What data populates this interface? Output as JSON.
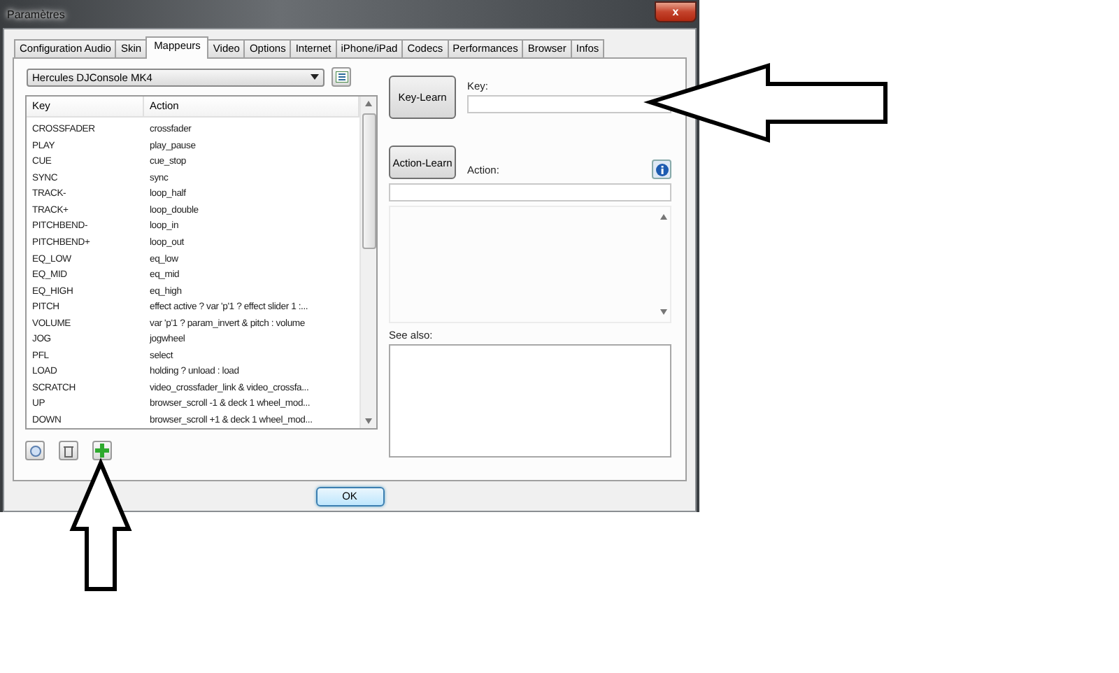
{
  "window": {
    "title": "Paramètres",
    "close_label": "x"
  },
  "tabs": [
    {
      "label": "Configuration Audio",
      "selected": false
    },
    {
      "label": "Skin",
      "selected": false
    },
    {
      "label": "Mappeurs",
      "selected": true
    },
    {
      "label": "Video",
      "selected": false
    },
    {
      "label": "Options",
      "selected": false
    },
    {
      "label": "Internet",
      "selected": false
    },
    {
      "label": "iPhone/iPad",
      "selected": false
    },
    {
      "label": "Codecs",
      "selected": false
    },
    {
      "label": "Performances",
      "selected": false
    },
    {
      "label": "Browser",
      "selected": false
    },
    {
      "label": "Infos",
      "selected": false
    }
  ],
  "device_select": {
    "value": "Hercules DJConsole MK4"
  },
  "mapping_table": {
    "columns": [
      "Key",
      "Action"
    ],
    "rows": [
      [
        "CROSSFADER",
        "crossfader"
      ],
      [
        "PLAY",
        "play_pause"
      ],
      [
        "CUE",
        "cue_stop"
      ],
      [
        "SYNC",
        "sync"
      ],
      [
        "TRACK-",
        "loop_half"
      ],
      [
        "TRACK+",
        "loop_double"
      ],
      [
        "PITCHBEND-",
        "loop_in"
      ],
      [
        "PITCHBEND+",
        "loop_out"
      ],
      [
        "EQ_LOW",
        "eq_low"
      ],
      [
        "EQ_MID",
        "eq_mid"
      ],
      [
        "EQ_HIGH",
        "eq_high"
      ],
      [
        "PITCH",
        "effect active ? var 'p'1 ? effect slider 1 :..."
      ],
      [
        "VOLUME",
        "var 'p'1 ? param_invert & pitch : volume"
      ],
      [
        "JOG",
        "jogwheel"
      ],
      [
        "PFL",
        "select"
      ],
      [
        "LOAD",
        "holding ? unload : load"
      ],
      [
        "SCRATCH",
        "video_crossfader_link & video_crossfa..."
      ],
      [
        "UP",
        "browser_scroll -1 & deck 1 wheel_mod..."
      ],
      [
        "DOWN",
        "browser_scroll +1 & deck 1 wheel_mod..."
      ]
    ]
  },
  "key_learn": {
    "button": "Key-Learn",
    "label": "Key:"
  },
  "action_learn": {
    "button": "Action-Learn",
    "label": "Action:"
  },
  "see_also": {
    "label": "See also:"
  },
  "ok_button": "OK"
}
